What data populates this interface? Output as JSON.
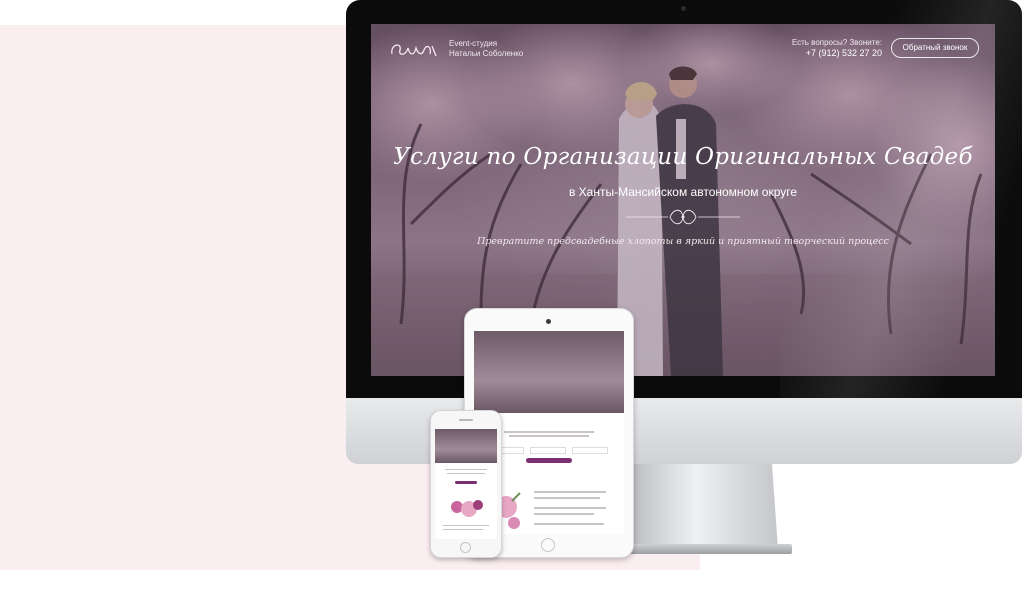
{
  "site": {
    "studio_line1": "Event-студия",
    "studio_line2": "Натальи Соболенко",
    "questions_label": "Есть вопросы? Звоните:",
    "phone": "+7 (912) 532 27 20",
    "callback_button": "Обратный звонок",
    "hero_title": "Услуги по Организации Оригинальных Свадеб",
    "hero_subtitle": "в Ханты-Мансийском автономном округе",
    "hero_tagline": "Превратите предсвадебные хлопоты в яркий и приятный творческий процесс"
  },
  "colors": {
    "page_background": "#ffffff",
    "pink_panel": "#fbeef0",
    "screen_tint": "#8a7584",
    "accent_button": "#7b2e72",
    "heading_script": "#6d4a6a"
  },
  "icons": {
    "logo": "event-script-logo-icon",
    "ornament": "flourish-divider-icon"
  }
}
